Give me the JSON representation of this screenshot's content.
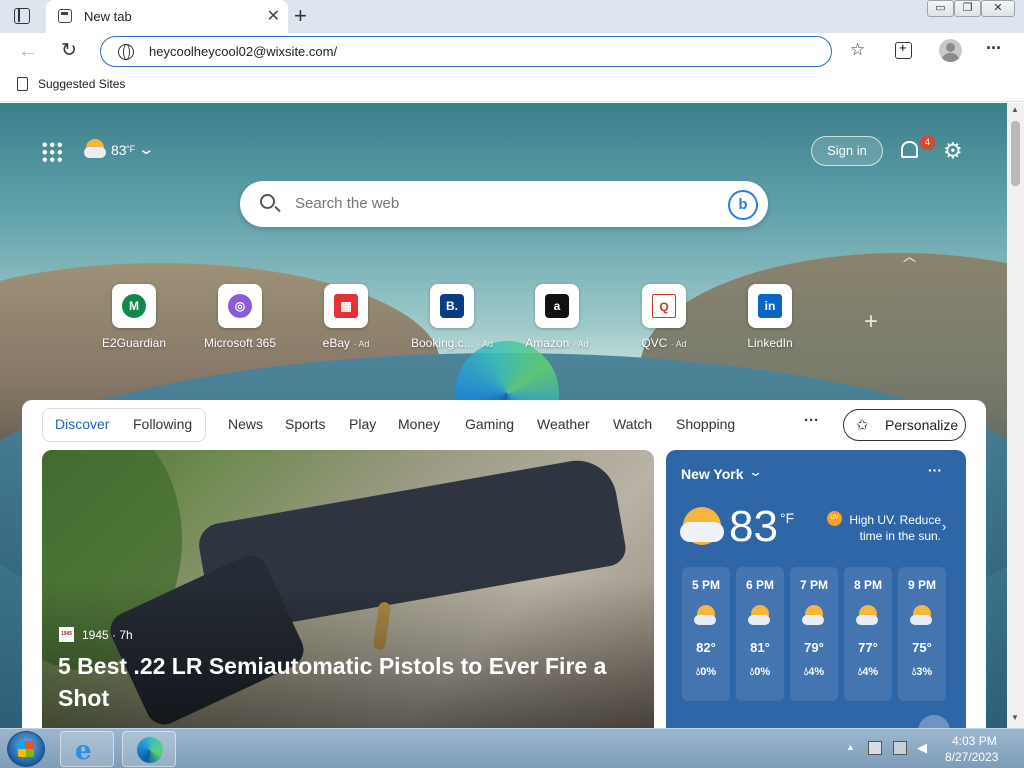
{
  "browser": {
    "tab_title": "New tab",
    "tab_close": "✕",
    "new_tab": "+",
    "url": "heycoolheycool02@wixsite.com/",
    "favorites_bar": {
      "items": [
        {
          "label": "Suggested Sites"
        }
      ]
    },
    "window_controls": {
      "minimize": "▭",
      "restore": "❐",
      "close": "✕"
    }
  },
  "newtab": {
    "weather_mini": {
      "temp": "83",
      "unit": "°F"
    },
    "sign_in": "Sign in",
    "notification_count": "4",
    "search": {
      "placeholder": "Search the web"
    },
    "quick_links": [
      {
        "label": "E2Guardian",
        "ad": "",
        "glyph": "M",
        "color": "#0f8a4a"
      },
      {
        "label": "Microsoft 365",
        "ad": "",
        "glyph": "◎",
        "color": "#8a5cd6"
      },
      {
        "label": "eBay",
        "ad": "· Ad",
        "glyph": "▦",
        "color": "#e53238"
      },
      {
        "label": "Booking.c...",
        "ad": "· Ad",
        "glyph": "B.",
        "color": "#0b3b84"
      },
      {
        "label": "Amazon",
        "ad": "· Ad",
        "glyph": "a",
        "color": "#111111"
      },
      {
        "label": "QVC",
        "ad": "· Ad",
        "glyph": "Q",
        "color": "#c0392b"
      },
      {
        "label": "LinkedIn",
        "ad": "",
        "glyph": "in",
        "color": "#0a66c2"
      }
    ]
  },
  "feed": {
    "tabs": [
      "Discover",
      "Following",
      "News",
      "Sports",
      "Play",
      "Money",
      "Gaming",
      "Weather",
      "Watch",
      "Shopping"
    ],
    "more": "···",
    "personalize": "Personalize",
    "hero": {
      "source_logo": "1945",
      "source": "1945 · 7h",
      "title": "5 Best .22 LR Semiautomatic Pistols to Ever Fire a Shot"
    },
    "weather": {
      "city": "New York",
      "more": "···",
      "temp": "83",
      "unit": "°F",
      "uv_badge": "UV",
      "alert": "High UV. Reduce time in the sun.",
      "hourly": [
        {
          "time": "5 PM",
          "temp": "82°",
          "precip": "0%"
        },
        {
          "time": "6 PM",
          "temp": "81°",
          "precip": "0%"
        },
        {
          "time": "7 PM",
          "temp": "79°",
          "precip": "4%"
        },
        {
          "time": "8 PM",
          "temp": "77°",
          "precip": "4%"
        },
        {
          "time": "9 PM",
          "temp": "75°",
          "precip": "3%"
        }
      ]
    }
  },
  "taskbar": {
    "clock_time": "4:03 PM",
    "clock_date": "8/27/2023"
  }
}
